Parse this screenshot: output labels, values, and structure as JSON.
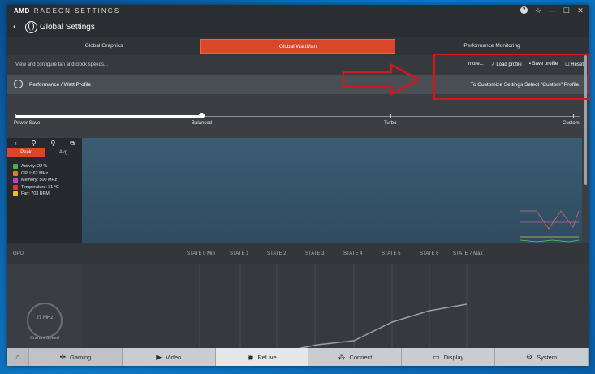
{
  "title_bar": {
    "brand": "AMD",
    "product": "RADEON SETTINGS",
    "icons": [
      "help-icon",
      "star-icon",
      "minimize-icon",
      "maximize-icon",
      "close-icon"
    ]
  },
  "nav": {
    "back_glyph": "‹",
    "title": "Global Settings"
  },
  "tabs": [
    {
      "label": "Global Graphics"
    },
    {
      "label": "Global WattMan",
      "active": true
    },
    {
      "label": "Performance Monitoring"
    }
  ],
  "subbar": {
    "description": "View and configure fan and clock speeds...",
    "more": "more...",
    "load_profile": "Load profile",
    "save_profile": "Save profile",
    "reset": "Reset"
  },
  "profile": {
    "label": "Performance / Watt Profile",
    "hint": "To Customize Settings Select \"Custom\" Profile."
  },
  "slider": {
    "labels": [
      "Power Save",
      "Balanced",
      "Turbo",
      "Custom"
    ],
    "selected": "Balanced",
    "selected_index": 1
  },
  "monitor": {
    "peak": "Peak",
    "avg": "Avg",
    "items": [
      {
        "label": "Activity: 22 %",
        "color": "#4bb543"
      },
      {
        "label": "GPU: 62 MHz",
        "color": "#d9822b"
      },
      {
        "label": "Memory: 500 MHz",
        "color": "#c040c0"
      },
      {
        "label": "Temperature: 31 °C",
        "color": "#d93b3b"
      },
      {
        "label": "Fan: 703 RPM",
        "color": "#e3c12b"
      }
    ]
  },
  "gpu": {
    "label": "GPU",
    "states": [
      "STATE 0 Min",
      "STATE 1",
      "STATE 2",
      "STATE 3",
      "STATE 4",
      "STATE 5",
      "STATE 6",
      "STATE 7 Max"
    ],
    "dial_value": "27 MHz",
    "dial_label": "Current Speed"
  },
  "footer": [
    {
      "label": "Gaming",
      "icon": "gamepad-icon"
    },
    {
      "label": "Video",
      "icon": "play-icon"
    },
    {
      "label": "ReLive",
      "icon": "relive-icon"
    },
    {
      "label": "Connect",
      "icon": "connect-icon"
    },
    {
      "label": "Display",
      "icon": "display-icon"
    },
    {
      "label": "System",
      "icon": "system-icon"
    }
  ],
  "colors": {
    "accent": "#d9462a",
    "annotation": "#d8161a"
  }
}
